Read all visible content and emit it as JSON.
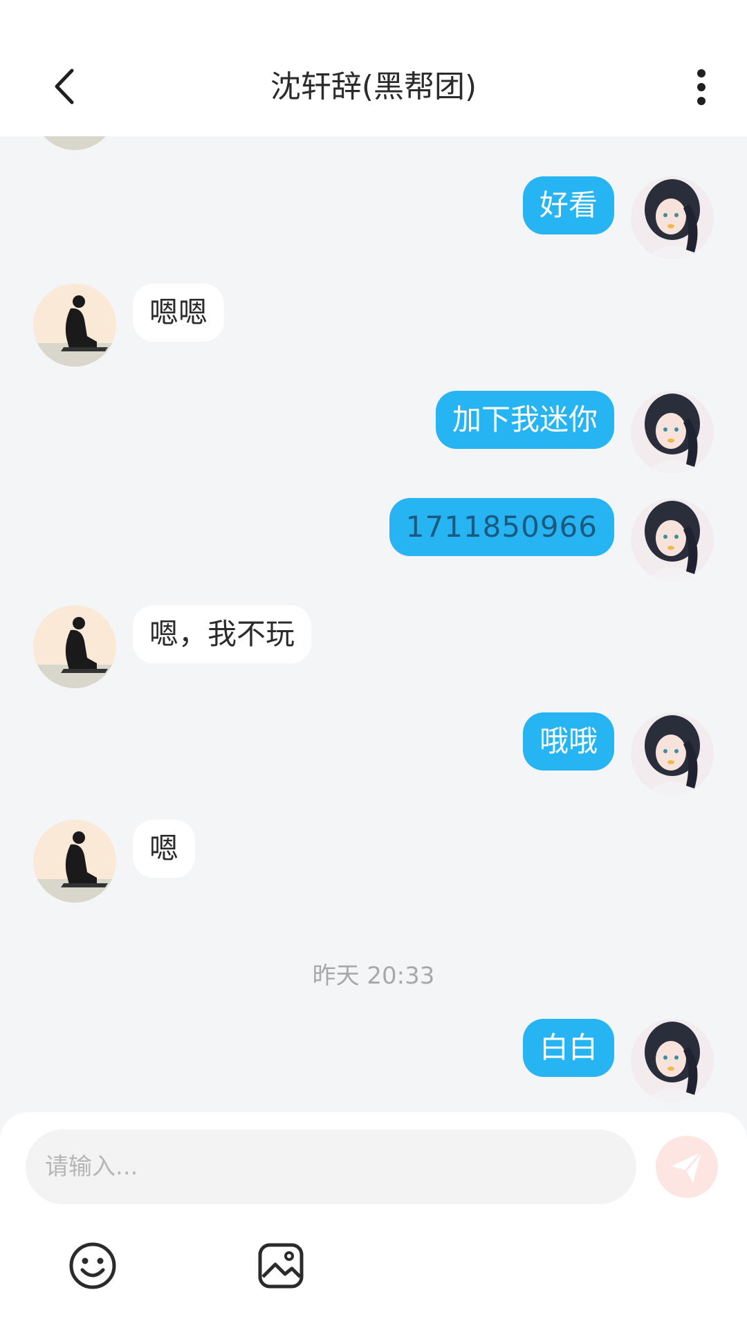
{
  "header": {
    "title": "沈轩辞(黑帮团)",
    "back_icon": "chevron-left-icon",
    "more_icon": "more-vertical-icon"
  },
  "messages": [
    {
      "sender": "me",
      "text": "好看"
    },
    {
      "sender": "other",
      "text": "嗯嗯"
    },
    {
      "sender": "me",
      "text": "加下我迷你"
    },
    {
      "sender": "me",
      "text": "1711850966"
    },
    {
      "sender": "other",
      "text": "嗯，我不玩"
    },
    {
      "sender": "me",
      "text": "哦哦"
    },
    {
      "sender": "other",
      "text": "嗯"
    },
    {
      "sender": "me",
      "text": "白白"
    }
  ],
  "timestamp": "昨天 20:33",
  "input": {
    "placeholder": "请输入..."
  },
  "icons": {
    "send": "send-icon",
    "emoji": "emoji-icon",
    "image": "image-icon"
  },
  "colors": {
    "my_bubble": "#27b4f2",
    "other_bubble": "#ffffff",
    "background": "#f3f5f7",
    "send_button": "#fde6e2"
  }
}
